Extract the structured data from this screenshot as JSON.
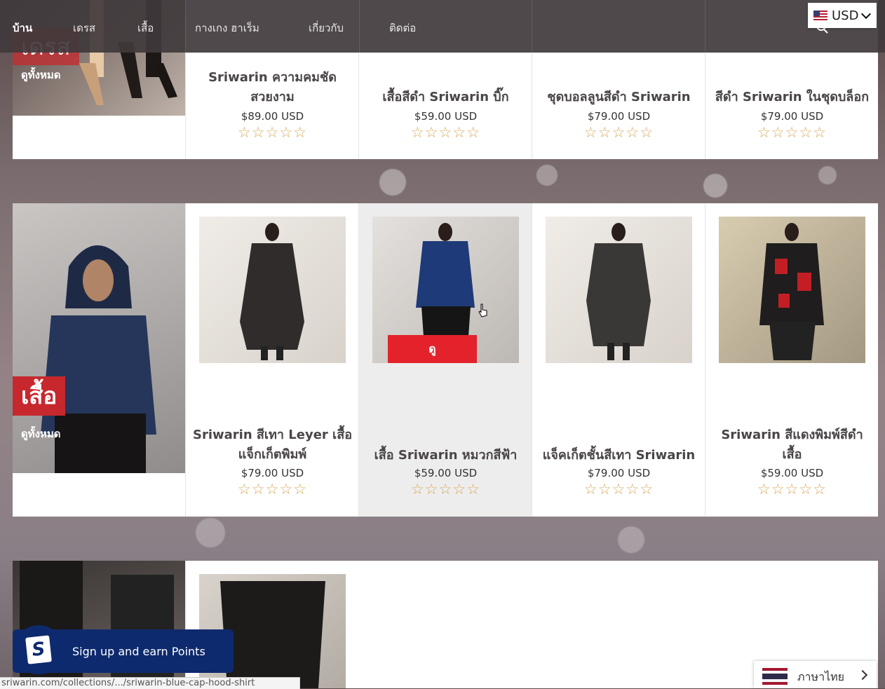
{
  "nav": {
    "items": [
      "บ้าน",
      "เดรส",
      "เสื้อ",
      "กางเกง ฮาเร็ม",
      "เกี่ยวกับ",
      "ติดต่อ"
    ],
    "currency": "USD"
  },
  "colors": {
    "accent": "#c6282e",
    "button": "#e4222c",
    "star": "#d7a85a",
    "rewards": "#0e2a6e"
  },
  "row1": {
    "category": {
      "label": "เดรส",
      "view_all": "ดูทั้งหมด"
    },
    "products": [
      {
        "name": "Sriwarin ความคมชัดสวยงาม",
        "price": "$89.00 USD",
        "rating": 0
      },
      {
        "name": "เสื้อสีดำ Sriwarin บิ๊ก",
        "price": "$59.00 USD",
        "rating": 0
      },
      {
        "name": "ชุดบอลลูนสีดำ Sriwarin",
        "price": "$79.00 USD",
        "rating": 0
      },
      {
        "name": "สีดำ Sriwarin ในชุดบล็อก",
        "price": "$79.00 USD",
        "rating": 0
      }
    ]
  },
  "row2": {
    "category": {
      "label": "เสื้อ",
      "view_all": "ดูทั้งหมด"
    },
    "view_button": "ดู",
    "products": [
      {
        "name": "Sriwarin สีเทา Leyer เสื้อแจ็กเก็ตพิมพ์",
        "price": "$79.00 USD",
        "rating": 0
      },
      {
        "name": "เสื้อ Sriwarin หมวกสีฟ้า",
        "price": "$59.00 USD",
        "rating": 0
      },
      {
        "name": "แจ็คเก็ตชั้นสีเทา Sriwarin",
        "price": "$79.00 USD",
        "rating": 0
      },
      {
        "name": "Sriwarin สีแดงพิมพ์สีดำเสื้อ",
        "price": "$59.00 USD",
        "rating": 0
      }
    ]
  },
  "rewards": {
    "label": "Sign up and earn Points"
  },
  "status_url": "sriwarin.com/collections/.../sriwarin-blue-cap-hood-shirt",
  "language": {
    "label": "ภาษาไทย"
  },
  "stars": "☆☆☆☆☆"
}
